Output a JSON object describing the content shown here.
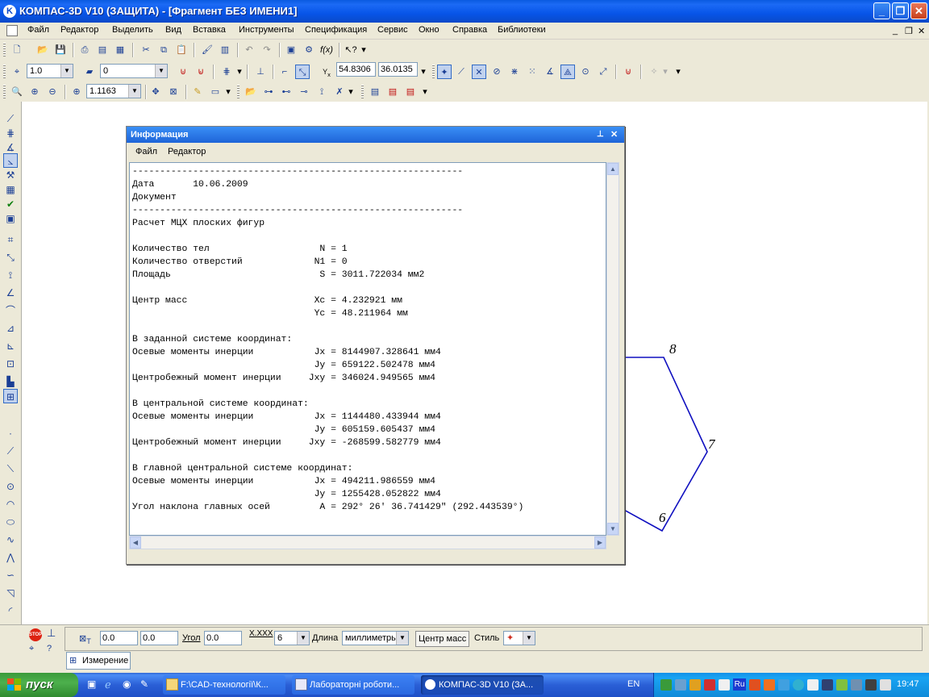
{
  "window": {
    "title": "КОМПАС-3D V10 (ЗАЩИТА) - [Фрагмент БЕЗ ИМЕНИ1]"
  },
  "menu": {
    "items": [
      "Файл",
      "Редактор",
      "Выделить",
      "Вид",
      "Вставка",
      "Инструменты",
      "Спецификация",
      "Сервис",
      "Окно",
      "Справка",
      "Библиотеки"
    ]
  },
  "toolbar2": {
    "step": "1.0",
    "layer": "0",
    "coord_x": "54.8306",
    "coord_y": "36.0135"
  },
  "toolbar3": {
    "zoom": "1.1163"
  },
  "info": {
    "title": "Информация",
    "menu": [
      "Файл",
      "Редактор"
    ],
    "lines": [
      "------------------------------------------------------------",
      "Дата       10.06.2009",
      "Документ",
      "------------------------------------------------------------",
      "Расчет МЦХ плоских фигур",
      "",
      "Количество тел                    N = 1",
      "Количество отверстий             N1 = 0",
      "Площадь                           S = 3011.722034 мм2",
      "",
      "Центр масс                       Xc = 4.232921 мм",
      "                                 Yc = 48.211964 мм",
      "",
      "В заданной системе координат:",
      "Осевые моменты инерции           Jx = 8144907.328641 мм4",
      "                                 Jy = 659122.502478 мм4",
      "Центробежный момент инерции     Jxy = 346024.949565 мм4",
      "",
      "В центральной системе координат:",
      "Осевые моменты инерции           Jx = 1144480.433944 мм4",
      "                                 Jy = 605159.605437 мм4",
      "Центробежный момент инерции     Jxy = -268599.582779 мм4",
      "",
      "В главной центральной системе координат:",
      "Осевые моменты инерции           Jx = 494211.986559 мм4",
      "                                 Jy = 1255428.052822 мм4",
      "Угол наклона главных осей         A = 292° 26' 36.741429\" (292.443539°)"
    ]
  },
  "drawing": {
    "labels": [
      "8",
      "7",
      "6"
    ],
    "line_color": "#1010c0"
  },
  "props": {
    "t_x": "0.0",
    "t_y": "0.0",
    "angle_label": "Угол",
    "angle": "0.0",
    "precision_label": "X.XXX",
    "precision": "6",
    "length_label": "Длина",
    "length_unit": "миллиметры",
    "center_mass_button": "Центр масс",
    "style_label": "Стиль",
    "tab": "Измерение"
  },
  "taskbar": {
    "start": "пуск",
    "tasks": [
      "F:\\CAD-технології\\К...",
      "Лабораторні роботи...",
      "КОМПАС-3D V10 (ЗА..."
    ],
    "lang": "EN",
    "tray_ru": "Ru",
    "clock": "19:47"
  }
}
